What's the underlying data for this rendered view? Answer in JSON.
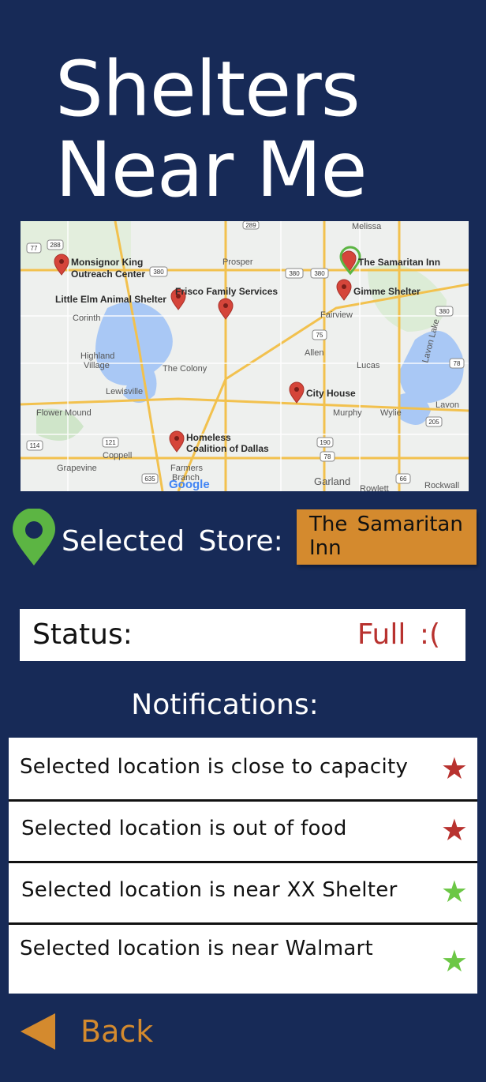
{
  "header": {
    "title_line1": "Shelters",
    "title_line2": "Near Me"
  },
  "map": {
    "pins": [
      {
        "label": "Monsignor King"
      },
      {
        "label": "Outreach Center"
      },
      {
        "label": "Little Elm Animal Shelter"
      },
      {
        "label": "Frisco Family Services"
      },
      {
        "label": "The Samaritan Inn"
      },
      {
        "label": "Gimme Shelter"
      },
      {
        "label": "City House"
      },
      {
        "label": "Homeless"
      },
      {
        "label": "Coalition of Dallas"
      }
    ],
    "towns": [
      "Melissa",
      "Prosper",
      "Corinth",
      "Highland",
      "Village",
      "The Colony",
      "Lewisville",
      "Flower Mound",
      "Coppell",
      "Grapevine",
      "Farmers",
      "Branch",
      "Fairview",
      "Allen",
      "Lucas",
      "Murphy",
      "Wylie",
      "Lavon",
      "Lavon Lake",
      "Garland",
      "Rowlett",
      "Rockwall",
      "Google"
    ],
    "route_shields": [
      "288",
      "77",
      "289",
      "380",
      "380",
      "380",
      "380",
      "75",
      "78",
      "121",
      "114",
      "190",
      "635",
      "66",
      "205",
      "78"
    ]
  },
  "selected": {
    "label": "Selected  Store:",
    "value": "The  Samaritan Inn"
  },
  "status": {
    "label": "Status:",
    "value": "Full  :("
  },
  "notifications": {
    "title": "Notifications:",
    "items": [
      {
        "text": "Selected location is close to capacity",
        "star_color": "#b8322f"
      },
      {
        "text": "Selected location is out of food",
        "star_color": "#b8322f"
      },
      {
        "text": "Selected location is near XX Shelter",
        "star_color": "#6cc746"
      },
      {
        "text": "Selected location is near Walmart",
        "star_color": "#6cc746"
      }
    ]
  },
  "nav": {
    "back_label": "Back"
  },
  "colors": {
    "background": "#172a57",
    "accent": "#d48a2e",
    "alert": "#b8322f",
    "ok": "#6cc746",
    "pin_green": "#5cb543"
  }
}
